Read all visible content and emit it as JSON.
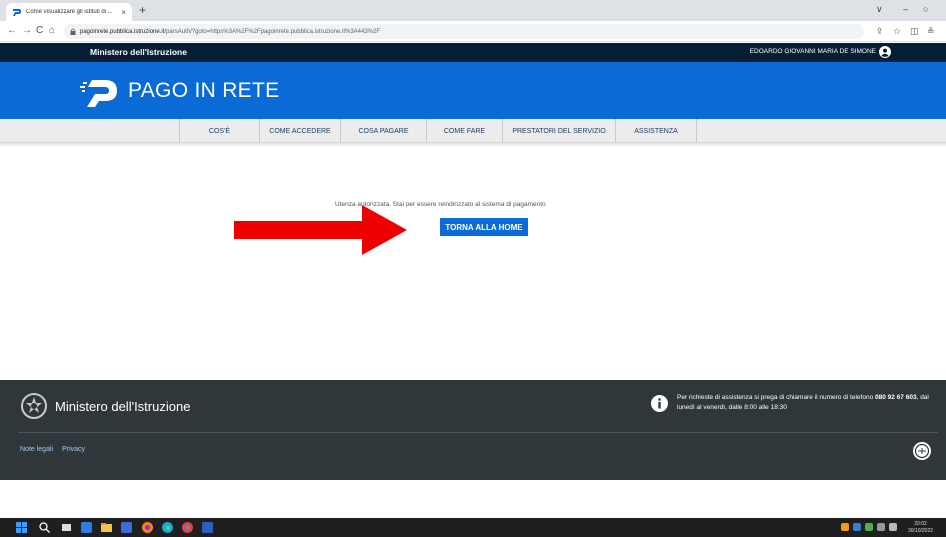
{
  "browser": {
    "tab_title": "Come visualizzare gli istituti di ...",
    "tab_close": "×",
    "new_tab": "+",
    "url_host": "pagoinrete.pubblica.istruzione.it",
    "url_path": "/parsAuth/?goto=https%3A%2F%2Fpagoinrete.pubblica.istruzione.it%3A443%2F",
    "back": "←",
    "forward": "→",
    "reload": "C",
    "home": "⌂",
    "minimize": "∨",
    "restore": "–",
    "maximize": "○",
    "share": "⇪",
    "bookmark": "☆",
    "sidepanel": "◫",
    "profile": "≗"
  },
  "header": {
    "ministry": "Ministero dell'Istruzione",
    "user": "EDOARDO GIOVANNI MARIA DE SIMONE",
    "brand": "PAGO IN RETE"
  },
  "menu": {
    "items": [
      {
        "label": "COS'È"
      },
      {
        "label": "COME ACCEDERE"
      },
      {
        "label": "COSA PAGARE"
      },
      {
        "label": "COME FARE"
      },
      {
        "label": "PRESTATORI DEL SERVIZIO"
      },
      {
        "label": "ASSISTENZA"
      }
    ]
  },
  "main": {
    "message": "Utenza autorizzata. Stai per essere reindirizzato al sistema di pagamento",
    "home_button": "TORNA ALLA HOME",
    "arrow_color": "#ee0000"
  },
  "footer": {
    "ministry": "Ministero dell'Istruzione",
    "assist_text": "Per richieste di assistenza si prega di chiamare il numero di telefono",
    "assist_phone": "080 92 67 603",
    "assist_hours": ", dal lunedì al venerdì, dalle 8:00 alle 18:30",
    "links": [
      {
        "label": "Note legali"
      },
      {
        "label": "Privacy"
      }
    ]
  },
  "taskbar": {
    "time": "20:02",
    "date": "30/10/2022"
  },
  "colors": {
    "brand_blue": "#0a6ad6",
    "dark_navy": "#061d36",
    "footer_bg": "#30373b"
  }
}
